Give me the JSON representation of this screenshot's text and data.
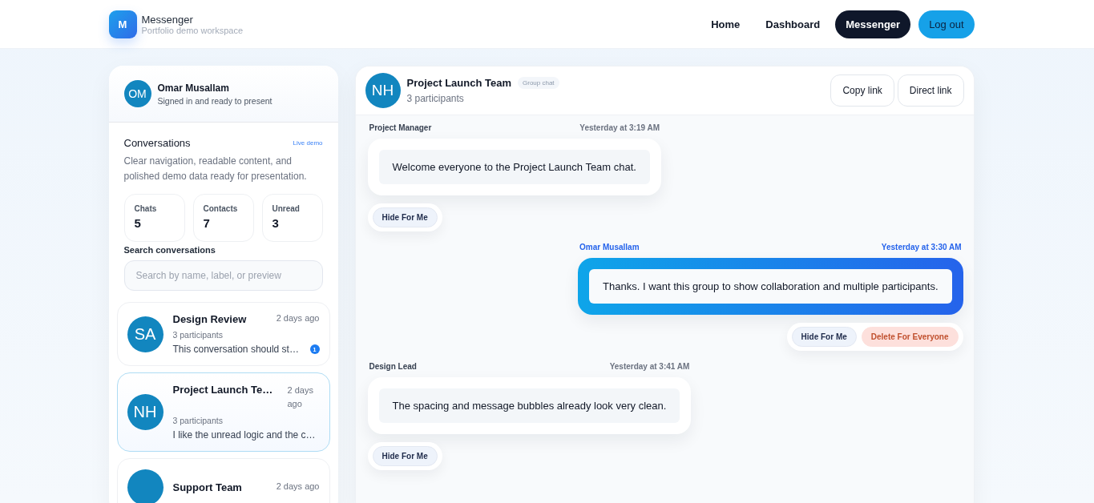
{
  "header": {
    "logo_letter": "M",
    "app_name": "Messenger",
    "tagline": "Portfolio demo workspace",
    "nav": [
      {
        "label": "Home",
        "selected": false,
        "kind": "link"
      },
      {
        "label": "Dashboard",
        "selected": false,
        "kind": "link"
      },
      {
        "label": "Messenger",
        "selected": true,
        "kind": "link"
      },
      {
        "label": "Log out",
        "selected": false,
        "kind": "primary"
      }
    ]
  },
  "sidebar": {
    "profile": {
      "initials": "OM",
      "name": "Omar Musallam",
      "status": "Signed in and ready to present"
    },
    "title": "Conversations",
    "tag": "Live demo",
    "description": "Clear navigation, readable content, and polished demo data ready for presentation.",
    "stats": [
      {
        "label": "Chats",
        "value": "5"
      },
      {
        "label": "Contacts",
        "value": "7"
      },
      {
        "label": "Unread",
        "value": "3"
      }
    ],
    "search": {
      "label": "Search conversations",
      "placeholder": "Search by name, label, or preview"
    },
    "conversations": [
      {
        "initials": "SA",
        "name": "Design Review",
        "time": "2 days ago",
        "participants": "3 participants",
        "preview": "This conversation should st…",
        "unread": "1",
        "selected": false
      },
      {
        "initials": "NH",
        "name": "Project Launch Te…",
        "time": "2 days ago",
        "participants": "3 participants",
        "preview": "I like the unread logic and the c…",
        "selected": true
      },
      {
        "name": "Support Team",
        "time": "2 days ago",
        "selected": false
      }
    ]
  },
  "chat": {
    "initials": "NH",
    "title": "Project Launch Team",
    "badge": "Group chat",
    "participants": "3 participants",
    "buttons": [
      "Copy link",
      "Direct link"
    ],
    "messages": [
      {
        "kind": "incoming",
        "sender": "Project Manager",
        "time": "Yesterday at 3:19 AM",
        "text": "Welcome everyone to the Project Launch Team chat.",
        "actions": [
          {
            "kind": "hide",
            "label": "Hide For Me"
          }
        ]
      },
      {
        "kind": "outgoing",
        "sender": "Omar Musallam",
        "time": "Yesterday at 3:30 AM",
        "text": "Thanks. I want this group to show collaboration and multiple participants.",
        "actions": [
          {
            "kind": "hide",
            "label": "Hide For Me"
          },
          {
            "kind": "delete",
            "label": "Delete For Everyone"
          }
        ]
      },
      {
        "kind": "incoming",
        "sender": "Design Lead",
        "time": "Yesterday at 3:41 AM",
        "text": "The spacing and message bubbles already look very clean.",
        "actions": [
          {
            "kind": "hide",
            "label": "Hide For Me"
          }
        ]
      }
    ]
  }
}
